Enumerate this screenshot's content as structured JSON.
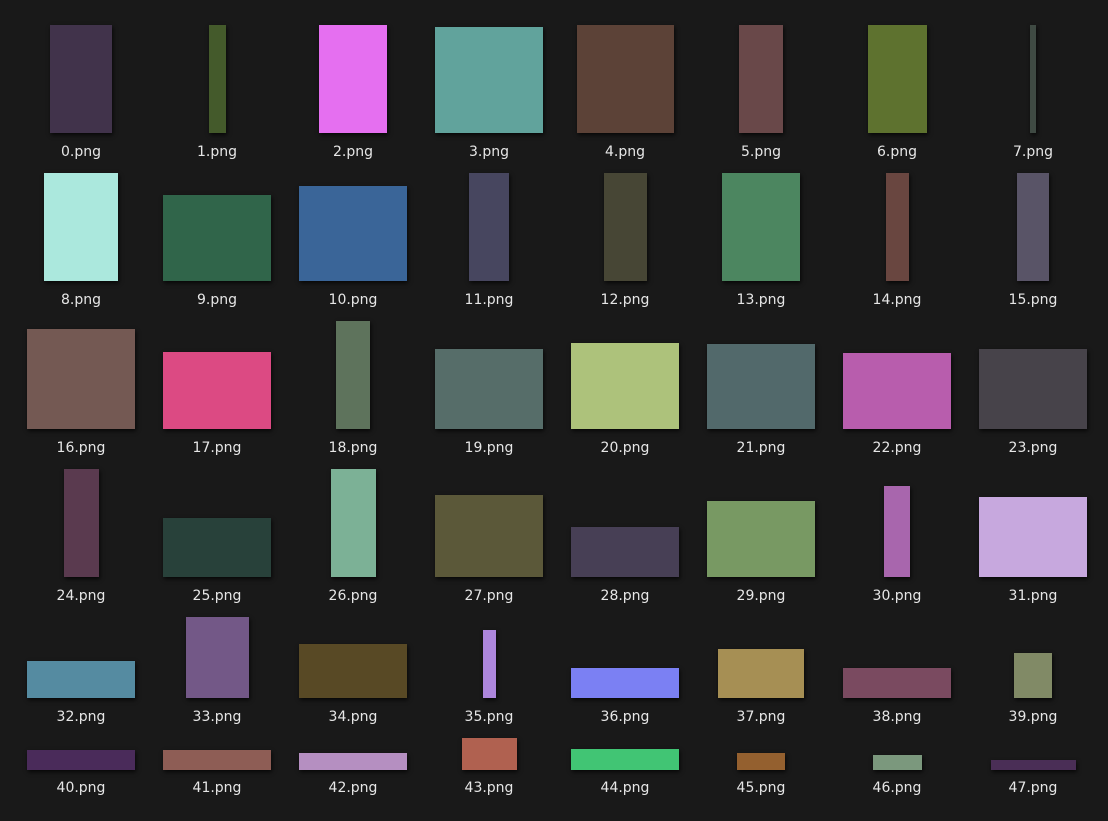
{
  "files": [
    {
      "name": "0.png",
      "color": "#41334b"
    },
    {
      "name": "1.png",
      "color": "#445a2b"
    },
    {
      "name": "2.png",
      "color": "#e56ff0"
    },
    {
      "name": "3.png",
      "color": "#61a39c"
    },
    {
      "name": "4.png",
      "color": "#5c4237"
    },
    {
      "name": "5.png",
      "color": "#694849"
    },
    {
      "name": "6.png",
      "color": "#5e722f"
    },
    {
      "name": "7.png",
      "color": "#3f4a43"
    },
    {
      "name": "8.png",
      "color": "#abe8dd"
    },
    {
      "name": "9.png",
      "color": "#30654a"
    },
    {
      "name": "10.png",
      "color": "#3a6598"
    },
    {
      "name": "11.png",
      "color": "#47465f"
    },
    {
      "name": "12.png",
      "color": "#474635"
    },
    {
      "name": "13.png",
      "color": "#4c8660"
    },
    {
      "name": "14.png",
      "color": "#694640"
    },
    {
      "name": "15.png",
      "color": "#595467"
    },
    {
      "name": "16.png",
      "color": "#745953"
    },
    {
      "name": "17.png",
      "color": "#dc4a83"
    },
    {
      "name": "18.png",
      "color": "#5e735c"
    },
    {
      "name": "19.png",
      "color": "#566d69"
    },
    {
      "name": "20.png",
      "color": "#adc27b"
    },
    {
      "name": "21.png",
      "color": "#52696b"
    },
    {
      "name": "22.png",
      "color": "#b85dad"
    },
    {
      "name": "23.png",
      "color": "#47434a"
    },
    {
      "name": "24.png",
      "color": "#5a3a4f"
    },
    {
      "name": "25.png",
      "color": "#28413a"
    },
    {
      "name": "26.png",
      "color": "#7cb196"
    },
    {
      "name": "27.png",
      "color": "#5b5839"
    },
    {
      "name": "28.png",
      "color": "#473f55"
    },
    {
      "name": "29.png",
      "color": "#789963"
    },
    {
      "name": "30.png",
      "color": "#a866ad"
    },
    {
      "name": "31.png",
      "color": "#c7a8de"
    },
    {
      "name": "32.png",
      "color": "#558ba1"
    },
    {
      "name": "33.png",
      "color": "#735887"
    },
    {
      "name": "34.png",
      "color": "#584925"
    },
    {
      "name": "35.png",
      "color": "#ad86dc"
    },
    {
      "name": "36.png",
      "color": "#7b80f3"
    },
    {
      "name": "37.png",
      "color": "#a68f54"
    },
    {
      "name": "38.png",
      "color": "#7a4a60"
    },
    {
      "name": "39.png",
      "color": "#818a66"
    },
    {
      "name": "40.png",
      "color": "#4a2b5a"
    },
    {
      "name": "41.png",
      "color": "#8e5d55"
    },
    {
      "name": "42.png",
      "color": "#b58fc1"
    },
    {
      "name": "43.png",
      "color": "#b06150"
    },
    {
      "name": "44.png",
      "color": "#41c574"
    },
    {
      "name": "45.png",
      "color": "#94602f"
    },
    {
      "name": "46.png",
      "color": "#7b987d"
    },
    {
      "name": "47.png",
      "color": "#4a2e56"
    }
  ]
}
